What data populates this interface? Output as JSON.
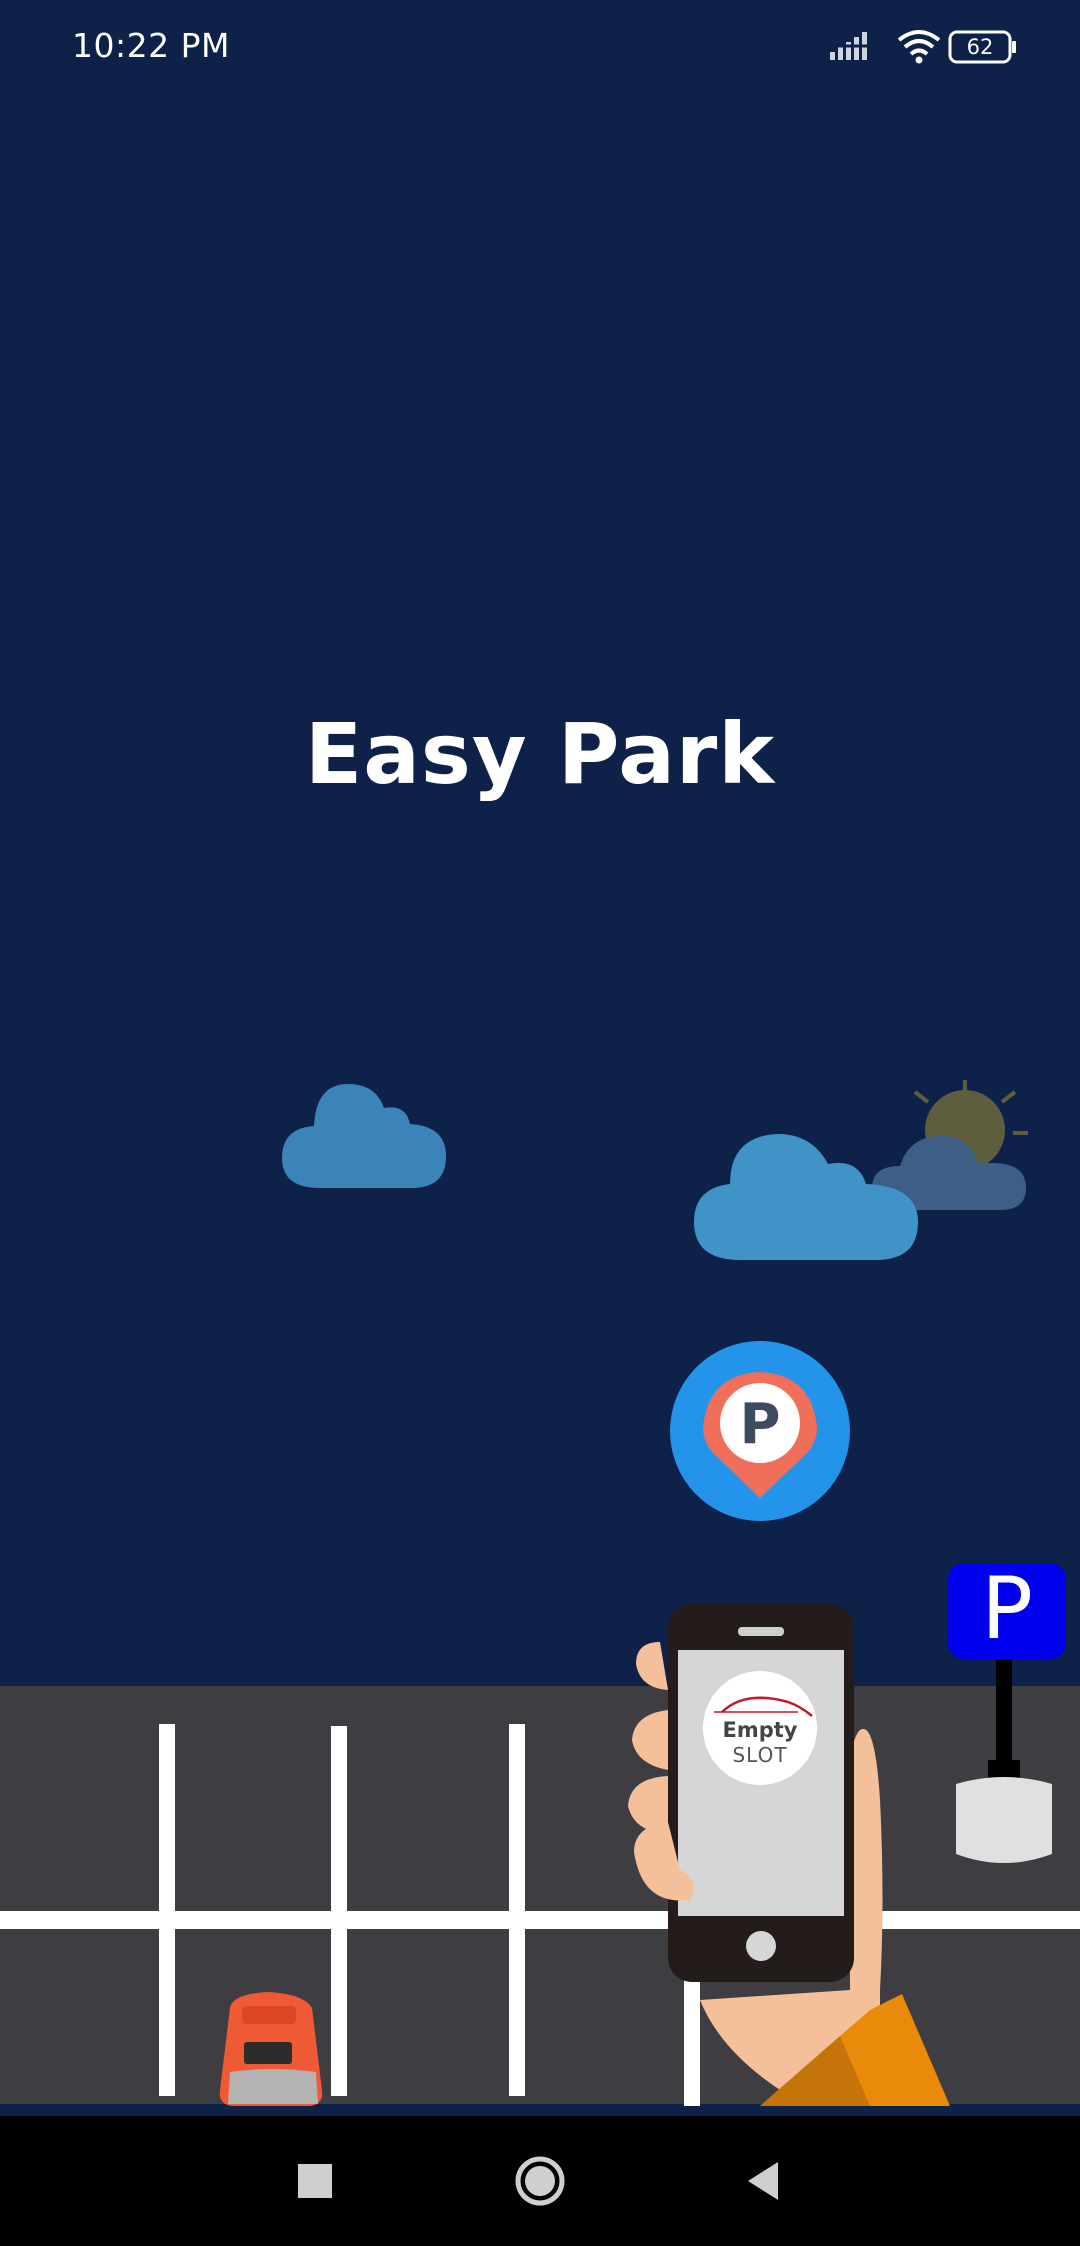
{
  "status_bar": {
    "time": "10:22 PM",
    "battery_level": "62",
    "icons": [
      "signal-icon",
      "wifi-icon",
      "battery-icon"
    ]
  },
  "splash": {
    "title": "Easy Park"
  },
  "illustration": {
    "phone_screen_text_line1": "Empty",
    "phone_screen_text_line2": "SLOT",
    "parking_sign_letter": "P",
    "pin_letter": "P"
  },
  "nav_bar": {
    "icons": [
      "recents-square-icon",
      "home-circle-icon",
      "back-triangle-icon"
    ]
  },
  "colors": {
    "background": "#0d2149",
    "road": "#3d3d42",
    "cloud": "#3f92c6",
    "pin_circle": "#2394ea",
    "pin_marker": "#ef6f5b",
    "parking_sign": "#0000ee",
    "car": "#ef5a34",
    "skin": "#f4c09a",
    "sleeve": "#ea8a0a"
  }
}
